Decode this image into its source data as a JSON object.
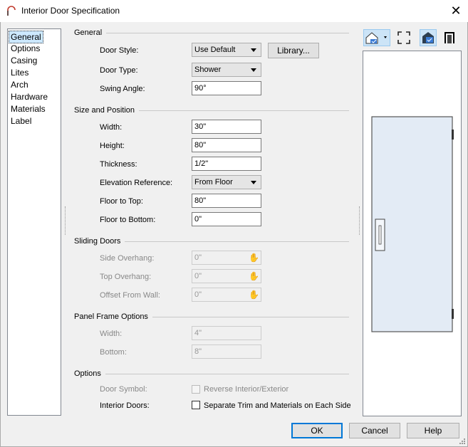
{
  "window": {
    "title": "Interior Door Specification",
    "close_label": "✕"
  },
  "nav": {
    "items": [
      "General",
      "Options",
      "Casing",
      "Lites",
      "Arch",
      "Hardware",
      "Materials",
      "Label"
    ],
    "selected": "General"
  },
  "general": {
    "heading": "General",
    "door_style_label": "Door Style:",
    "door_style_value": "Use Default",
    "library_button": "Library...",
    "door_type_label": "Door Type:",
    "door_type_value": "Shower",
    "swing_angle_label": "Swing Angle:",
    "swing_angle_value": "90°"
  },
  "size": {
    "heading": "Size and Position",
    "width_label": "Width:",
    "width_value": "30\"",
    "height_label": "Height:",
    "height_value": "80\"",
    "thickness_label": "Thickness:",
    "thickness_value": "1/2\"",
    "elev_ref_label": "Elevation Reference:",
    "elev_ref_value": "From Floor",
    "floor_top_label": "Floor to Top:",
    "floor_top_value": "80\"",
    "floor_bottom_label": "Floor to Bottom:",
    "floor_bottom_value": "0\""
  },
  "sliding": {
    "heading": "Sliding Doors",
    "side_overhang_label": "Side Overhang:",
    "side_overhang_value": "0\"",
    "top_overhang_label": "Top Overhang:",
    "top_overhang_value": "0\"",
    "offset_label": "Offset From Wall:",
    "offset_value": "0\""
  },
  "panel": {
    "heading": "Panel Frame Options",
    "width_label": "Width:",
    "width_value": "4\"",
    "bottom_label": "Bottom:",
    "bottom_value": "8\""
  },
  "options": {
    "heading": "Options",
    "door_symbol_label": "Door Symbol:",
    "reverse_label": "Reverse Interior/Exterior",
    "interior_doors_label": "Interior Doors:",
    "separate_label": "Separate Trim and Materials on Each Side"
  },
  "buttons": {
    "ok": "OK",
    "cancel": "Cancel",
    "help": "Help"
  },
  "colors": {
    "accent": "#0078d7",
    "door_fill": "#e3ebf5",
    "selected_bg": "#cce8ff"
  }
}
